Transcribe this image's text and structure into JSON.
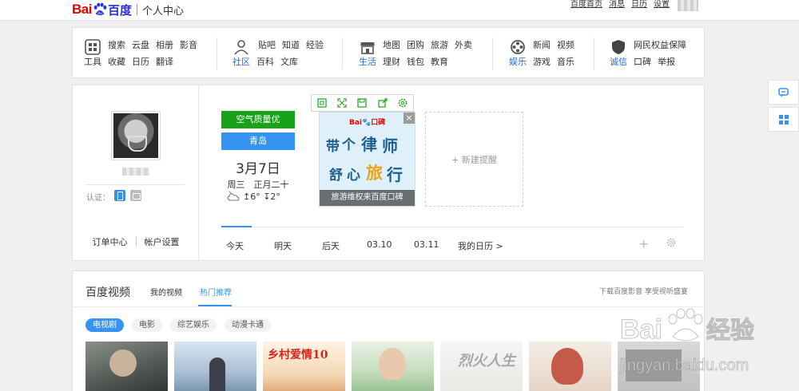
{
  "header": {
    "logo_bai": "Bai",
    "logo_du": "百度",
    "logo_sub": "个人中心",
    "links": [
      "百度首页",
      "消息",
      "日历",
      "设置"
    ]
  },
  "nav": {
    "groups": [
      {
        "icon": "apps-grid-icon",
        "row1": [
          "搜索",
          "云盘",
          "相册",
          "影音"
        ],
        "row2": [
          "工具",
          "收藏",
          "日历",
          "翻译"
        ]
      },
      {
        "icon": "community-people-icon",
        "row1": [
          "贴吧",
          "知道",
          "经验"
        ],
        "row2": [
          "社区",
          "百科",
          "文库"
        ]
      },
      {
        "icon": "store-icon",
        "row1": [
          "地图",
          "团购",
          "旅游",
          "外卖"
        ],
        "row2": [
          "生活",
          "理财",
          "钱包",
          "教育"
        ]
      },
      {
        "icon": "film-reel-icon",
        "row1": [
          "新闻",
          "视频"
        ],
        "row2": [
          "娱乐",
          "游戏",
          "音乐"
        ]
      },
      {
        "icon": "shield-icon",
        "row1": [
          "网民权益保障"
        ],
        "row2": [
          "诚信",
          "口碑",
          "举报"
        ]
      }
    ]
  },
  "profile": {
    "auth_label": "认证：",
    "order_center": "订单中心",
    "account_settings": "帐户设置"
  },
  "weather": {
    "air_quality": "空气质量优",
    "city": "青岛",
    "date": "3月7日",
    "weekday_lunar": "周三　正月二十",
    "temp": "↥6° ↧2°"
  },
  "ad": {
    "logo_text": "Bai",
    "logo_sub": "口碑",
    "art_text": [
      "带",
      "个",
      "律",
      "师",
      "舒",
      "心",
      "旅",
      "行"
    ],
    "caption": "旅游维权来百度口碑",
    "close": "×"
  },
  "reminder": {
    "label": "+ 新建提醒"
  },
  "days": [
    "今天",
    "明天",
    "后天",
    "03.10",
    "03.11",
    "我的日历 >"
  ],
  "video": {
    "title": "百度视频",
    "tab_mine": "我的视频",
    "tab_hot": "热门推荐",
    "right_text": "下载百度影音 享受视听盛宴",
    "pills": [
      "电视剧",
      "电影",
      "综艺娱乐",
      "动漫卡通"
    ],
    "poster_texts": [
      "",
      "",
      "乡村爱情10",
      "",
      "烈火人生",
      "",
      ""
    ]
  },
  "watermark": {
    "text1": "Bai",
    "text2": "经验",
    "url": "jingyan.baidu.com"
  },
  "colors": {
    "brand_red": "#e10601",
    "brand_blue": "#2932e1",
    "accent_blue": "#3593f2",
    "air_green": "#19a219"
  }
}
